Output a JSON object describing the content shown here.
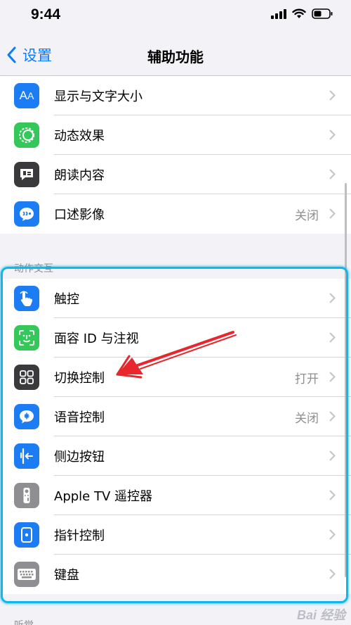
{
  "status_bar": {
    "time": "9:44"
  },
  "nav": {
    "back_label": "设置",
    "title": "辅助功能"
  },
  "group1": {
    "rows": [
      {
        "label": "显示与文字大小",
        "value": "",
        "icon": "text-size-icon",
        "color": "#1c7cf4"
      },
      {
        "label": "动态效果",
        "value": "",
        "icon": "motion-icon",
        "color": "#34c759"
      },
      {
        "label": "朗读内容",
        "value": "",
        "icon": "speech-bubble-icon",
        "color": "#3a3a3c"
      },
      {
        "label": "口述影像",
        "value": "关闭",
        "icon": "audio-description-icon",
        "color": "#1c7cf4"
      }
    ]
  },
  "section2": {
    "header": "动作交互",
    "rows": [
      {
        "label": "触控",
        "value": "",
        "icon": "touch-hand-icon",
        "color": "#1c7cf4"
      },
      {
        "label": "面容 ID 与注视",
        "value": "",
        "icon": "face-id-icon",
        "color": "#34c759"
      },
      {
        "label": "切换控制",
        "value": "打开",
        "icon": "switch-control-icon",
        "color": "#3a3a3c"
      },
      {
        "label": "语音控制",
        "value": "关闭",
        "icon": "voice-control-icon",
        "color": "#1c7cf4"
      },
      {
        "label": "侧边按钮",
        "value": "",
        "icon": "side-button-icon",
        "color": "#1c7cf4"
      },
      {
        "label": "Apple TV 遥控器",
        "value": "",
        "icon": "tv-remote-icon",
        "color": "#8e8e93"
      },
      {
        "label": "指针控制",
        "value": "",
        "icon": "pointer-control-icon",
        "color": "#1c7cf4"
      },
      {
        "label": "键盘",
        "value": "",
        "icon": "keyboard-icon",
        "color": "#8e8e93"
      }
    ]
  },
  "section3": {
    "header": "听觉"
  },
  "annotation": {
    "highlight_color": "#13b6ea",
    "arrow_color": "#e8262d"
  },
  "watermark": {
    "text": "Bai 经验"
  }
}
